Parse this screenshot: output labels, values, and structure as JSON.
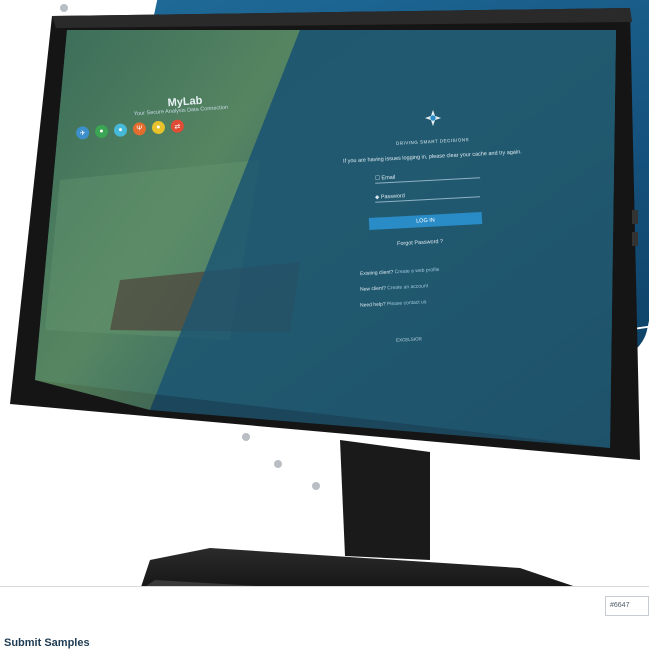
{
  "login": {
    "app_title": "MyLab",
    "app_subtitle": "Your Secure Analysis Data Connection",
    "app_icons": [
      {
        "icon": "satellite-icon",
        "glyph": "✈",
        "color": "#3c8fc9"
      },
      {
        "icon": "leaf-icon",
        "glyph": "●",
        "color": "#3aa653"
      },
      {
        "icon": "drop-icon",
        "glyph": "●",
        "color": "#46b9d9"
      },
      {
        "icon": "grain-icon",
        "glyph": "Ψ",
        "color": "#e36d2f"
      },
      {
        "icon": "flask-icon",
        "glyph": "●",
        "color": "#e8c22b"
      },
      {
        "icon": "tools-icon",
        "glyph": "⇄",
        "color": "#e04c36"
      }
    ],
    "tagline": "DRIVING SMART DECISIONS",
    "notice": "If you are having issues logging in, please clear your cache and try again.",
    "email_placeholder": "Email",
    "password_placeholder": "Password",
    "login_button": "LOG IN",
    "forgot_password": "Forgot Password ?",
    "help": [
      {
        "label": "Existing client?",
        "link": "Create a web profile"
      },
      {
        "label": "New client?",
        "link": "Create an account"
      },
      {
        "label": "Need help?",
        "link": "Please contact us"
      }
    ],
    "partner": "EXCELSIOR"
  },
  "page": {
    "sample_id": "#6647",
    "section_title": "Submit Samples"
  }
}
